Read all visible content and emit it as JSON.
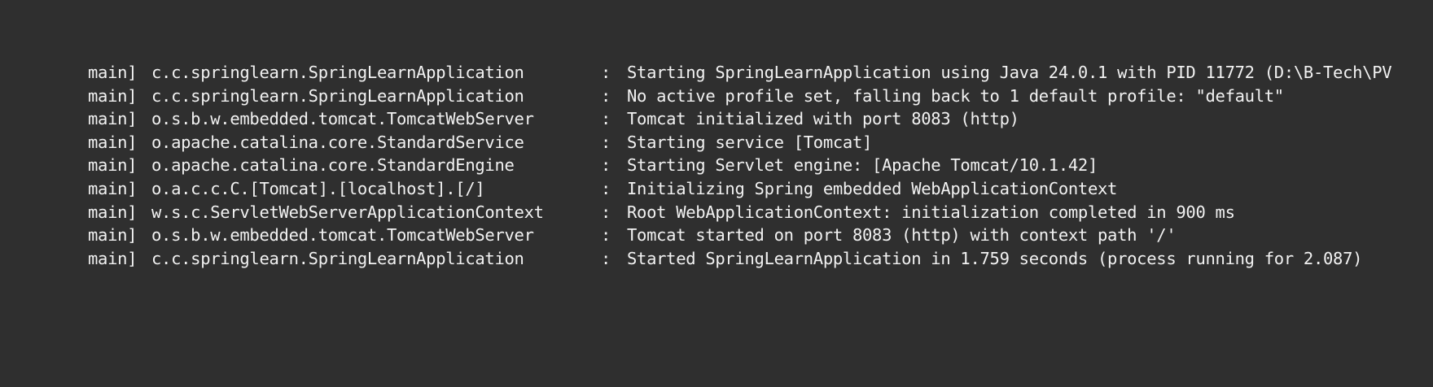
{
  "console": {
    "lines": [
      {
        "thread": "main]",
        "logger": "c.c.springlearn.SpringLearnApplication",
        "sep": ":",
        "message": "Starting SpringLearnApplication using Java 24.0.1 with PID 11772 (D:\\B-Tech\\PV"
      },
      {
        "thread": "main]",
        "logger": "c.c.springlearn.SpringLearnApplication",
        "sep": ":",
        "message": "No active profile set, falling back to 1 default profile: \"default\""
      },
      {
        "thread": "main]",
        "logger": "o.s.b.w.embedded.tomcat.TomcatWebServer",
        "sep": ":",
        "message": "Tomcat initialized with port 8083 (http)"
      },
      {
        "thread": "main]",
        "logger": "o.apache.catalina.core.StandardService",
        "sep": ":",
        "message": "Starting service [Tomcat]"
      },
      {
        "thread": "main]",
        "logger": "o.apache.catalina.core.StandardEngine",
        "sep": ":",
        "message": "Starting Servlet engine: [Apache Tomcat/10.1.42]"
      },
      {
        "thread": "main]",
        "logger": "o.a.c.c.C.[Tomcat].[localhost].[/]",
        "sep": ":",
        "message": "Initializing Spring embedded WebApplicationContext"
      },
      {
        "thread": "main]",
        "logger": "w.s.c.ServletWebServerApplicationContext",
        "sep": ":",
        "message": "Root WebApplicationContext: initialization completed in 900 ms"
      },
      {
        "thread": "main]",
        "logger": "o.s.b.w.embedded.tomcat.TomcatWebServer",
        "sep": ":",
        "message": "Tomcat started on port 8083 (http) with context path '/'"
      },
      {
        "thread": "main]",
        "logger": "c.c.springlearn.SpringLearnApplication",
        "sep": ":",
        "message": "Started SpringLearnApplication in 1.759 seconds (process running for 2.087)"
      }
    ]
  },
  "colors": {
    "background": "#2f2f2f",
    "text": "#f2f2f2"
  }
}
